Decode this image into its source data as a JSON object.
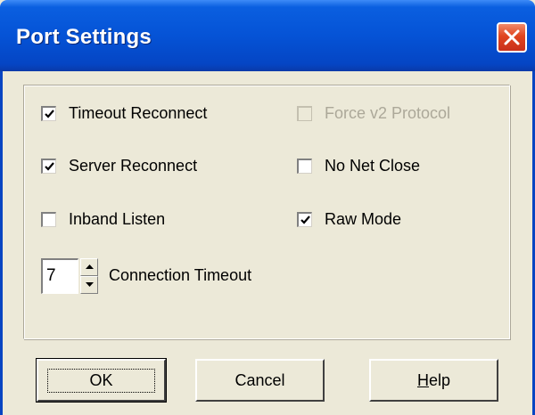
{
  "window": {
    "title": "Port Settings",
    "close_icon": "close-icon"
  },
  "options": {
    "timeout_reconnect": {
      "label": "Timeout Reconnect",
      "checked": true,
      "enabled": true
    },
    "force_v2_protocol": {
      "label": "Force v2 Protocol",
      "checked": false,
      "enabled": false
    },
    "server_reconnect": {
      "label": "Server Reconnect",
      "checked": true,
      "enabled": true
    },
    "no_net_close": {
      "label": "No Net Close",
      "checked": false,
      "enabled": true
    },
    "inband_listen": {
      "label": "Inband Listen",
      "checked": false,
      "enabled": true
    },
    "raw_mode": {
      "label": "Raw Mode",
      "checked": true,
      "enabled": true
    }
  },
  "connection_timeout": {
    "value": "7",
    "label": "Connection Timeout"
  },
  "buttons": {
    "ok": "OK",
    "cancel": "Cancel",
    "help": "Help"
  },
  "colors": {
    "titlebar": "#0553d6",
    "close_button": "#e0451f",
    "dialog_bg": "#ece9d8",
    "disabled_text": "#aca899"
  }
}
